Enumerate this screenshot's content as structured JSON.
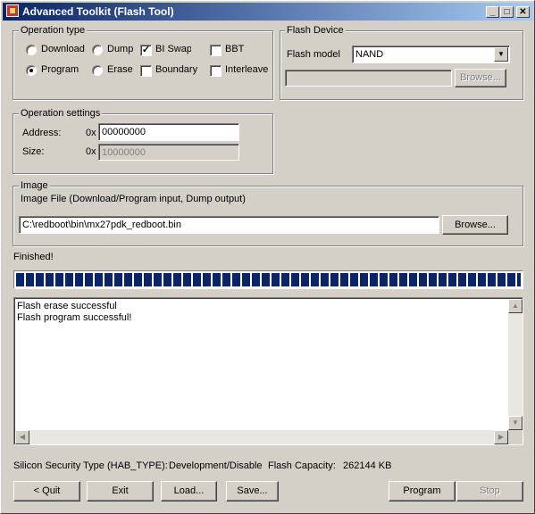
{
  "window": {
    "title": "Advanced Toolkit (Flash Tool)",
    "caption_buttons": {
      "minimize": "_",
      "maximize": "□",
      "close": "✕"
    }
  },
  "operation_type": {
    "label": "Operation type",
    "download": "Download",
    "dump": "Dump",
    "bi_swap": "BI Swap",
    "bbt": "BBT",
    "program": "Program",
    "erase": "Erase",
    "boundary": "Boundary",
    "interleave": "Interleave",
    "selected": "Program",
    "bi_swap_checked": true,
    "bbt_checked": false,
    "boundary_checked": false,
    "interleave_checked": false
  },
  "flash_device": {
    "label": "Flash Device",
    "model_label": "Flash model",
    "model_value": "NAND",
    "path_value": "",
    "browse_label": "Browse..."
  },
  "operation_settings": {
    "label": "Operation settings",
    "address_label": "Address:",
    "address_prefix": "0x",
    "address_value": "00000000",
    "size_label": "Size:",
    "size_prefix": "0x",
    "size_value": "10000000"
  },
  "image": {
    "label": "Image",
    "description": "Image File (Download/Program input, Dump output)",
    "file_value": "C:\\redboot\\bin\\mx27pdk_redboot.bin",
    "browse_label": "Browse..."
  },
  "status": {
    "text": "Finished!",
    "progress_percent": 100
  },
  "log": {
    "lines": [
      "Flash erase successful",
      "Flash program successful!"
    ]
  },
  "info": {
    "security_label": "Silicon Security Type (HAB_TYPE):",
    "security_value": "Development/Disable",
    "capacity_label": "Flash Capacity:",
    "capacity_value": "262144 KB"
  },
  "buttons": {
    "quit": "< Quit",
    "exit": "Exit",
    "load": "Load...",
    "save": "Save...",
    "program": "Program",
    "stop": "Stop"
  }
}
